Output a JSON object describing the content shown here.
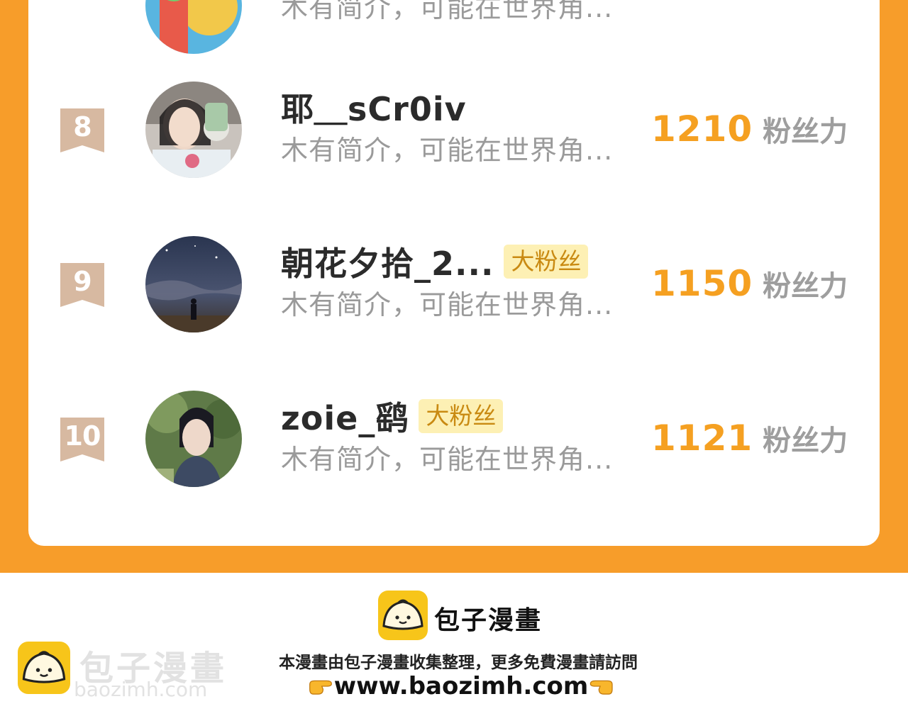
{
  "leaderboard": {
    "previous_row": {
      "bio": "木有简介，可能在世界角..."
    },
    "rows": [
      {
        "rank": "8",
        "name": "耶＿sCr0iv",
        "badge": "",
        "bio": "木有简介，可能在世界角...",
        "score": "1210",
        "score_unit": "粉丝力",
        "rank_color": "#d7b9a1"
      },
      {
        "rank": "9",
        "name": "朝花夕拾_2...",
        "badge": "大粉丝",
        "bio": "木有简介，可能在世界角...",
        "score": "1150",
        "score_unit": "粉丝力",
        "rank_color": "#d7b9a1"
      },
      {
        "rank": "10",
        "name": "zoie_鹞",
        "badge": "大粉丝",
        "bio": "木有简介，可能在世界角...",
        "score": "1121",
        "score_unit": "粉丝力",
        "rank_color": "#d7b9a1"
      }
    ]
  },
  "footer": {
    "brand": "包子漫畫",
    "note": "本漫畫由包子漫畫收集整理，更多免費漫畫請訪問",
    "url": "www.baozimh.com",
    "left_icon": "pointing-right-hand-icon",
    "right_icon": "pointing-left-hand-icon"
  },
  "watermark": {
    "brand": "包子漫畫",
    "url": "baozimh.com"
  },
  "colors": {
    "accent": "#f79d2a",
    "score": "#f5a021",
    "badge_bg": "#fdf0b4"
  }
}
